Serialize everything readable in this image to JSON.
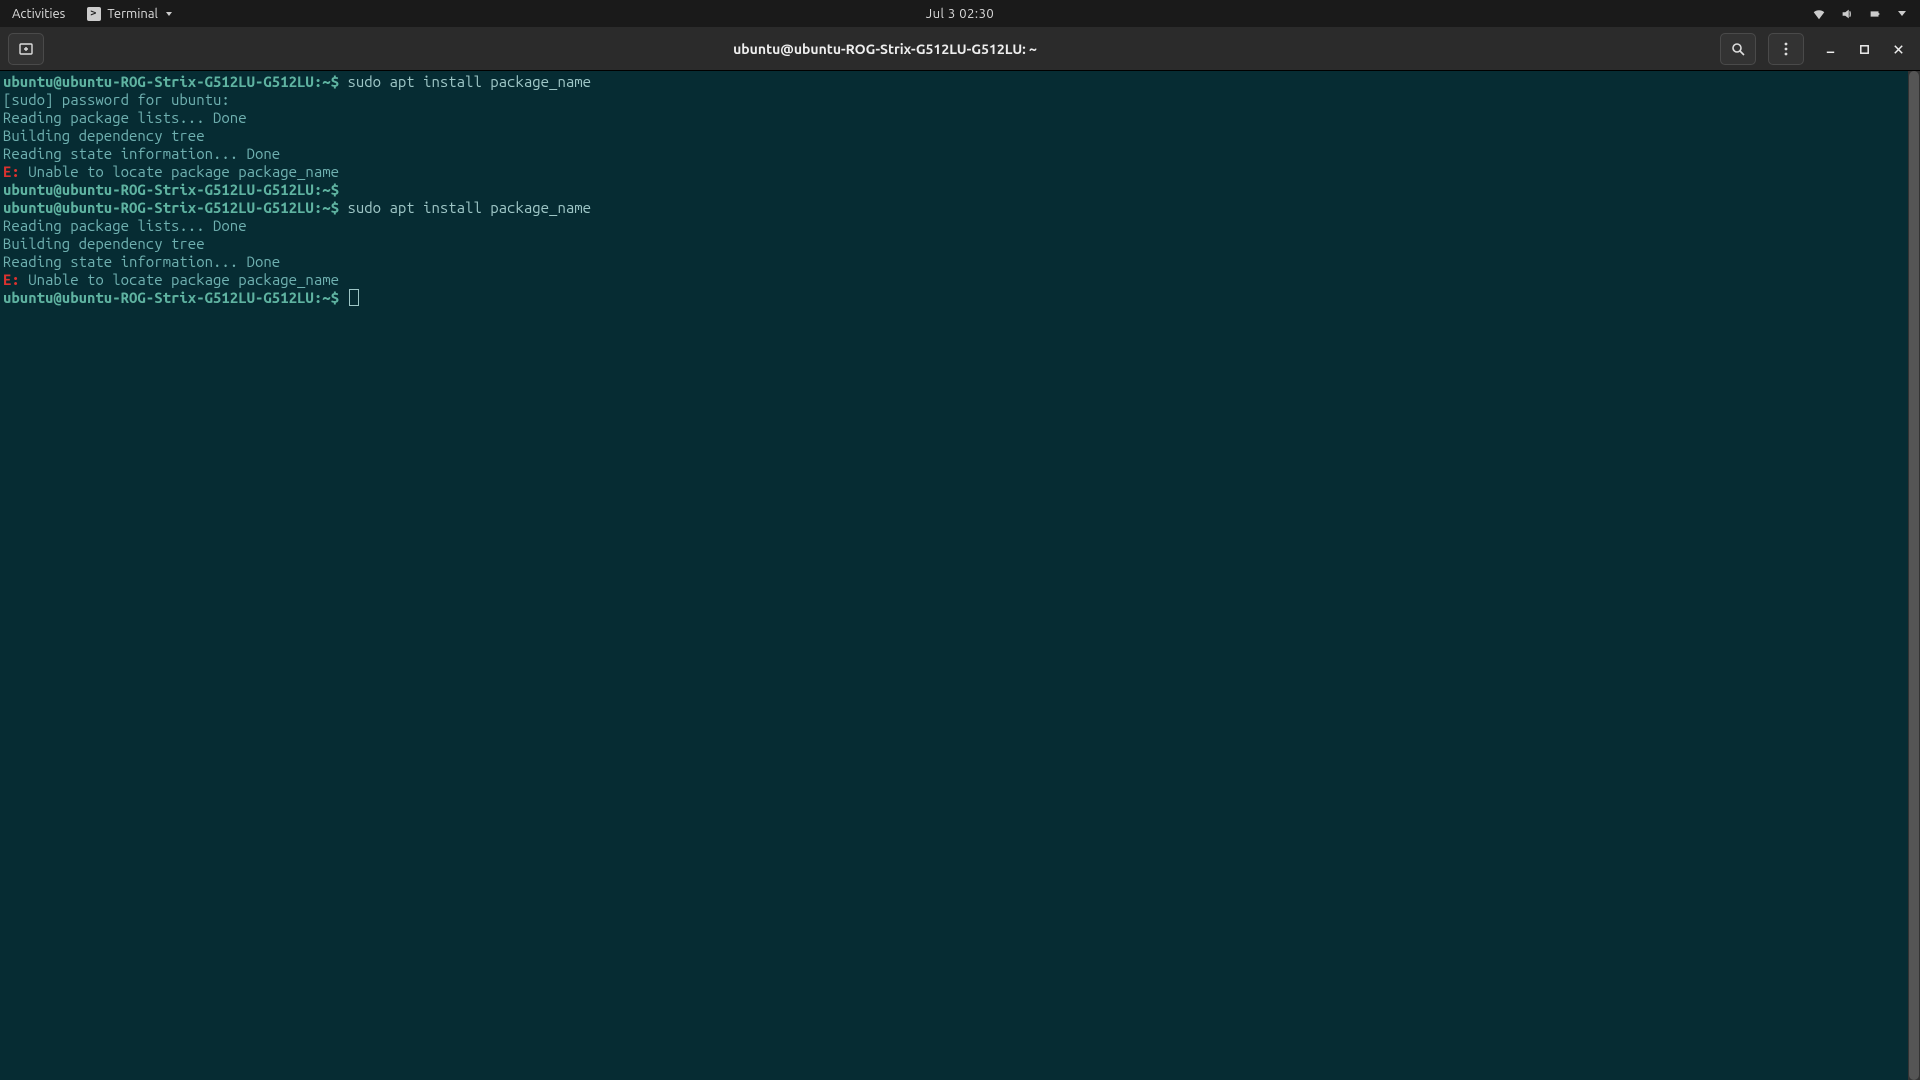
{
  "top_panel": {
    "activities": "Activities",
    "app_name": "Terminal",
    "clock": "Jul 3  02:30"
  },
  "window": {
    "title": "ubuntu@ubuntu-ROG-Strix-G512LU-G512LU: ~"
  },
  "prompt": {
    "user_host": "ubuntu@ubuntu-ROG-Strix-G512LU-G512LU",
    "sep": ":",
    "path": "~",
    "sym": "$"
  },
  "session": {
    "cmd1": "sudo apt install package_name",
    "sudo_prompt": "[sudo] password for ubuntu:",
    "read_lists": "Reading package lists... Done",
    "build_tree": "Building dependency tree",
    "read_state": "Reading state information... Done",
    "err_prefix": "E:",
    "err_msg": " Unable to locate package package_name",
    "empty": "",
    "cmd2": "sudo apt install package_name"
  }
}
